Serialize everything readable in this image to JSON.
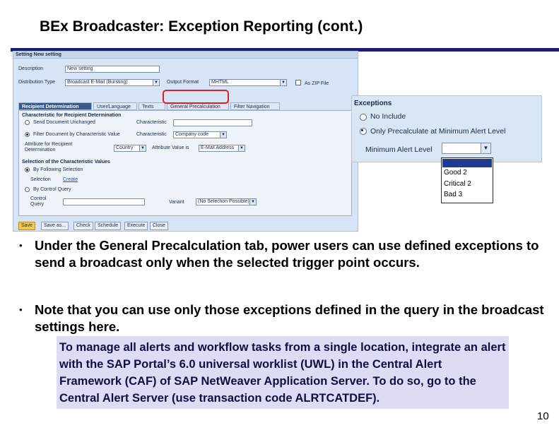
{
  "slide": {
    "title": "BEx Broadcaster: Exception Reporting (cont.)",
    "page_number": "10",
    "accent_color": "#1e1e7a"
  },
  "sap": {
    "header": "Setting New setting",
    "description_label": "Description",
    "description_value": "New setting",
    "distribution_label": "Distribution Type",
    "distribution_value": "Broadcast E-Mail (Bursting)",
    "output_label": "Output Format",
    "output_value": "MHTML",
    "zip_label": "As ZIP File",
    "tabs": [
      "Recipient Determination",
      "User/Language",
      "Texts",
      "General Precalculation",
      "Filter Navigation"
    ],
    "char_section_title": "Characteristic for Recipient Determination",
    "send_unchanged": "Send Document Unchanged",
    "filter_by_value": "Filter Document by Characteristic Value",
    "characteristic_label": "Characteristic",
    "characteristic_value": "Company code",
    "attribute_label": "Attribute for Recipient Determination",
    "attribute_value": "Country",
    "attribute_is_label": "Attribute Value is",
    "attribute_is_value": "E-Mail Address",
    "selection_section_title": "Selection of the Characteristic Values",
    "by_following": "By Following Selection",
    "selection_label": "Selection",
    "selection_link": "Create",
    "by_control_query": "By Control Query",
    "control_query_label": "Control Query",
    "variant_label": "Variant",
    "variant_value": "(No Selection Possible)",
    "buttons": [
      "Save",
      "Save as...",
      "Check",
      "Schedule",
      "Execute",
      "Close"
    ]
  },
  "exceptions": {
    "title": "Exceptions",
    "no_include": "No Include",
    "only_precalc": "Only Precalculate at Minimum Alert Level",
    "min_alert_label": "Minimum Alert Level",
    "min_alert_value": "",
    "options": [
      "Good 2",
      "Critical 2",
      "Bad 3"
    ]
  },
  "bullets": [
    "Under the General Precalculation tab, power users can use defined exceptions to send a broadcast only when the selected trigger point occurs.",
    "Note that you can use only those exceptions defined in the query in the broadcast settings here."
  ],
  "note": "To manage all alerts and workflow tasks from a single location, integrate an alert with the SAP Portal’s 6.0 universal worklist (UWL) in the Central Alert Framework (CAF) of SAP NetWeaver Application Server. To do so, go to the Central Alert Server (use transaction code ALRTCATDEF)."
}
